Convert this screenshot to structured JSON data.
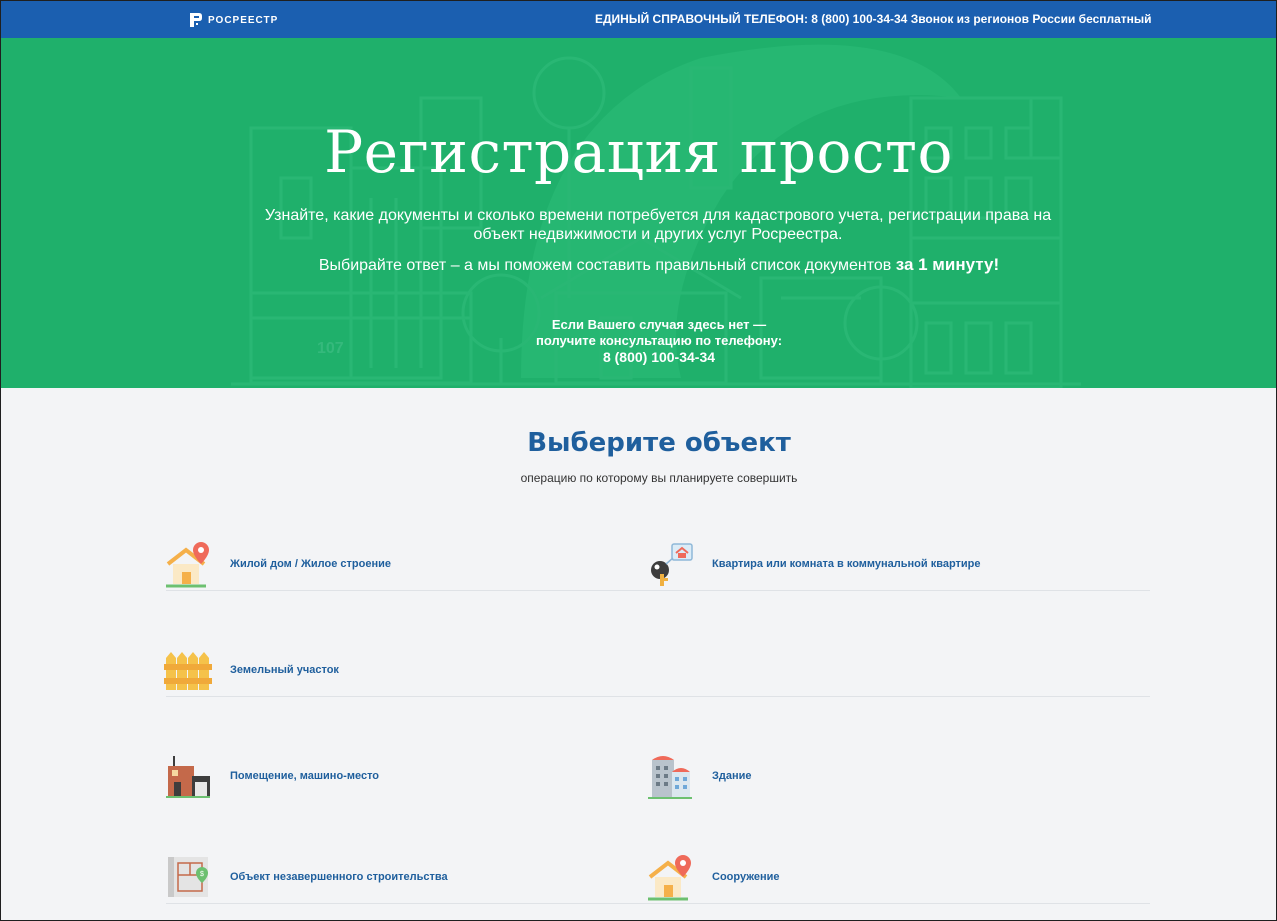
{
  "header": {
    "logo_text": "РОСРЕЕСТР",
    "phone_text": "ЕДИНЫЙ СПРАВОЧНЫЙ ТЕЛЕФОН: 8 (800) 100-34-34 Звонок из регионов России бесплатный"
  },
  "hero": {
    "title": "Регистрация просто",
    "subtitle": "Узнайте, какие документы и сколько времени потребуется для кадастрового учета, регистрации права на объект недвижимости и других услуг Росреестра.",
    "choose_text": "Выбирайте ответ – а мы поможем составить правильный список документов",
    "choose_bold": "за 1 минуту!",
    "building_number": "107",
    "consult_line1": "Если Вашего случая здесь нет —",
    "consult_line2": "получите консультацию по телефону:",
    "consult_phone": "8 (800) 100-34-34"
  },
  "objects_section": {
    "title": "Выберите объект",
    "subtitle": "операцию по которому вы планируете совершить",
    "items": [
      {
        "label": "Жилой дом / Жилое строение",
        "icon": "house-pin-icon"
      },
      {
        "label": "Квартира или комната в коммунальной квартире",
        "icon": "key-tag-icon"
      },
      {
        "label": "Земельный участок",
        "icon": "fence-icon"
      },
      {
        "label": "Помещение, машино-место",
        "icon": "garage-icon"
      },
      {
        "label": "Здание",
        "icon": "building-icon"
      },
      {
        "label": "Объект незавершенного строительства",
        "icon": "blueprint-icon"
      },
      {
        "label": "Сооружение",
        "icon": "structure-pin-icon"
      }
    ]
  },
  "colors": {
    "header_bg": "#1b5fb0",
    "hero_bg": "#1fb06b",
    "accent_blue": "#1f5f9d",
    "page_bg": "#f3f4f6"
  }
}
